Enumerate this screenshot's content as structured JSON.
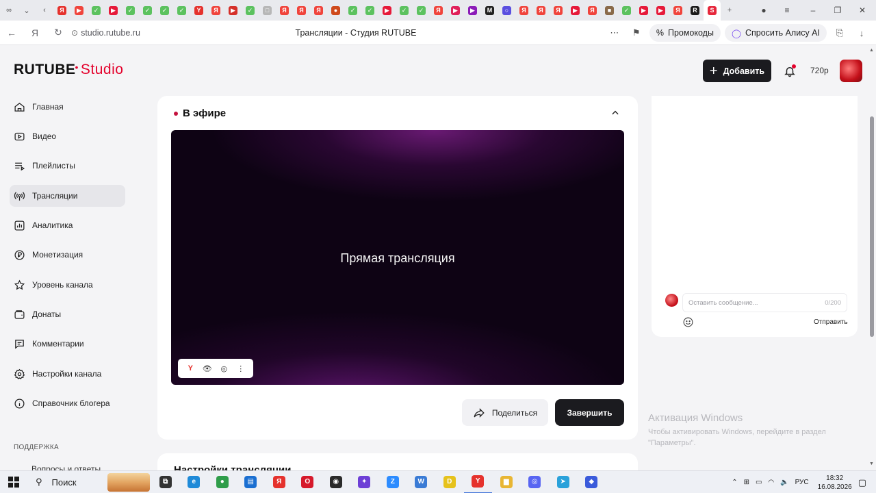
{
  "browser": {
    "url": "studio.rutube.ru",
    "tab_title": "Трансляции - Студия RUTUBE",
    "promo_label": "Промокоды",
    "alice_label": "Спросить Алису AI",
    "favicons": [
      {
        "letter": "Я",
        "color": "#e5322d"
      },
      {
        "letter": "▶",
        "color": "#f0443c"
      },
      {
        "letter": "✓",
        "color": "#5cc25f"
      },
      {
        "letter": "▶",
        "color": "#e61a3a"
      },
      {
        "letter": "✓",
        "color": "#5cc25f"
      },
      {
        "letter": "✓",
        "color": "#5cc25f"
      },
      {
        "letter": "✓",
        "color": "#5cc25f"
      },
      {
        "letter": "✓",
        "color": "#5cc25f"
      },
      {
        "letter": "Y",
        "color": "#e5322d"
      },
      {
        "letter": "Я",
        "color": "#f0443c"
      },
      {
        "letter": "▶",
        "color": "#d5302a"
      },
      {
        "letter": "✓",
        "color": "#5cc25f"
      },
      {
        "letter": "□",
        "color": "#b7b7b7"
      },
      {
        "letter": "Я",
        "color": "#f0443c"
      },
      {
        "letter": "Я",
        "color": "#f0443c"
      },
      {
        "letter": "Я",
        "color": "#f0443c"
      },
      {
        "letter": "●",
        "color": "#cf4a1c"
      },
      {
        "letter": "✓",
        "color": "#5cc25f"
      },
      {
        "letter": "✓",
        "color": "#5cc25f"
      },
      {
        "letter": "▶",
        "color": "#e61a3a"
      },
      {
        "letter": "✓",
        "color": "#5cc25f"
      },
      {
        "letter": "✓",
        "color": "#5cc25f"
      },
      {
        "letter": "Я",
        "color": "#f0443c"
      },
      {
        "letter": "▶",
        "color": "#e0205a"
      },
      {
        "letter": "▶",
        "color": "#8b1cb8"
      },
      {
        "letter": "M",
        "color": "#222222"
      },
      {
        "letter": "○",
        "color": "#5a4fe0"
      },
      {
        "letter": "Я",
        "color": "#f0443c"
      },
      {
        "letter": "Я",
        "color": "#f0443c"
      },
      {
        "letter": "Я",
        "color": "#f0443c"
      },
      {
        "letter": "▶",
        "color": "#e61a3a"
      },
      {
        "letter": "Я",
        "color": "#f0443c"
      },
      {
        "letter": "■",
        "color": "#8a6a4a"
      },
      {
        "letter": "✓",
        "color": "#5cc25f"
      },
      {
        "letter": "▶",
        "color": "#e61a3a"
      },
      {
        "letter": "▶",
        "color": "#e61a3a"
      },
      {
        "letter": "Я",
        "color": "#f0443c"
      },
      {
        "letter": "R",
        "color": "#1a1a1a"
      },
      {
        "letter": "S",
        "color": "#e6283c"
      }
    ]
  },
  "header": {
    "logo_main": "RUTUBE",
    "logo_sub": "Studio",
    "add_label": "Добавить",
    "quality": "720p"
  },
  "sidebar": {
    "items": [
      {
        "label": "Главная",
        "icon": "home-icon"
      },
      {
        "label": "Видео",
        "icon": "video-icon"
      },
      {
        "label": "Плейлисты",
        "icon": "playlist-icon"
      },
      {
        "label": "Трансляции",
        "icon": "broadcast-icon",
        "active": true
      },
      {
        "label": "Аналитика",
        "icon": "analytics-icon"
      },
      {
        "label": "Монетизация",
        "icon": "ruble-icon"
      },
      {
        "label": "Уровень канала",
        "icon": "star-icon"
      },
      {
        "label": "Донаты",
        "icon": "wallet-icon"
      },
      {
        "label": "Комментарии",
        "icon": "comment-icon"
      },
      {
        "label": "Настройки канала",
        "icon": "gear-icon"
      },
      {
        "label": "Справочник блогера",
        "icon": "info-icon"
      }
    ],
    "support_heading": "ПОДДЕРЖКА",
    "support_first_item": "Вопросы и ответы"
  },
  "live": {
    "status": "В эфире",
    "player_title": "Прямая трансляция",
    "share_label": "Поделиться",
    "finish_label": "Завершить",
    "status_color": "#c4113e"
  },
  "settings_section": {
    "title": "Настройки трансляции"
  },
  "chat": {
    "placeholder": "Оставить сообщение...",
    "counter": "0/200",
    "send_label": "Отправить"
  },
  "watermark": {
    "line1": "Активация Windows",
    "line2": "Чтобы активировать Windows, перейдите в раздел \"Параметры\"."
  },
  "taskbar": {
    "search_label": "Поиск",
    "apps": [
      {
        "name": "task-view-icon",
        "letter": "⧉",
        "color": "#333333"
      },
      {
        "name": "edge-icon",
        "letter": "e",
        "color": "#1f8ad8"
      },
      {
        "name": "chrome-icon",
        "letter": "●",
        "color": "#2f9d4a"
      },
      {
        "name": "files-icon",
        "letter": "▤",
        "color": "#1b6fd1"
      },
      {
        "name": "yandex-icon",
        "letter": "Я",
        "color": "#e5322d"
      },
      {
        "name": "opera-icon",
        "letter": "O",
        "color": "#d6192b"
      },
      {
        "name": "obs-icon",
        "letter": "◉",
        "color": "#2a2a2a"
      },
      {
        "name": "game-icon",
        "letter": "✦",
        "color": "#6d3fd6"
      },
      {
        "name": "zoom-icon",
        "letter": "Z",
        "color": "#2d8cff"
      },
      {
        "name": "workspace-icon",
        "letter": "W",
        "color": "#3a7bd5"
      },
      {
        "name": "donation-icon",
        "letter": "D",
        "color": "#e6c21c"
      },
      {
        "name": "yandex-browser-icon",
        "letter": "Y",
        "color": "#e5322d",
        "active": true
      },
      {
        "name": "explorer-icon",
        "letter": "▆",
        "color": "#e8b634"
      },
      {
        "name": "discord-icon",
        "letter": "◎",
        "color": "#5865f2"
      },
      {
        "name": "telegram-icon",
        "letter": "➤",
        "color": "#2aa1da"
      },
      {
        "name": "app-icon",
        "letter": "◆",
        "color": "#3b5bdb"
      }
    ],
    "lang": "РУС",
    "time": "18:32",
    "date": "16.08.2026"
  }
}
